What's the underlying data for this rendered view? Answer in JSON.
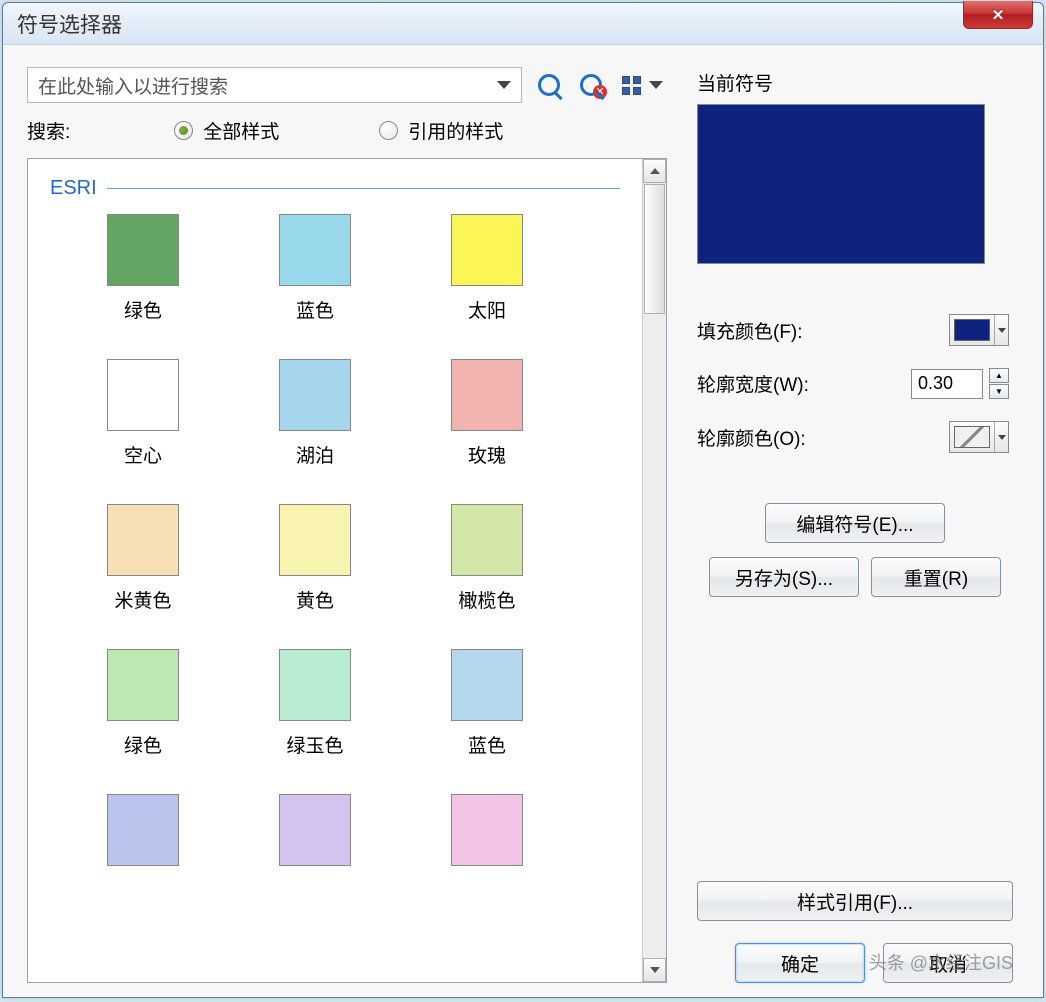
{
  "window": {
    "title": "符号选择器"
  },
  "search": {
    "placeholder": "在此处输入以进行搜索",
    "label": "搜索:",
    "radio_all": "全部样式",
    "radio_ref": "引用的样式"
  },
  "group": {
    "name": "ESRI"
  },
  "symbols": [
    {
      "label": "绿色",
      "color": "#63a563"
    },
    {
      "label": "蓝色",
      "color": "#9ad8eb"
    },
    {
      "label": "太阳",
      "color": "#fcf556"
    },
    {
      "label": "空心",
      "color": "#ffffff"
    },
    {
      "label": "湖泊",
      "color": "#a5d5eb"
    },
    {
      "label": "玫瑰",
      "color": "#f2b4b0"
    },
    {
      "label": "米黄色",
      "color": "#f7e0b5"
    },
    {
      "label": "黄色",
      "color": "#f8f3ae"
    },
    {
      "label": "橄榄色",
      "color": "#d3e8a8"
    },
    {
      "label": "绿色",
      "color": "#bce8b2"
    },
    {
      "label": "绿玉色",
      "color": "#b8ecd0"
    },
    {
      "label": "蓝色",
      "color": "#b6d8ee"
    },
    {
      "label": "",
      "color": "#bac5ee"
    },
    {
      "label": "",
      "color": "#d4c3f0"
    },
    {
      "label": "",
      "color": "#f4c4e6"
    }
  ],
  "current": {
    "label": "当前符号",
    "preview_color": "#0d237e",
    "fill_label": "填充颜色(F):",
    "fill_value": "#0d237e",
    "outline_width_label": "轮廓宽度(W):",
    "outline_width": "0.30",
    "outline_color_label": "轮廓颜色(O):"
  },
  "buttons": {
    "edit_symbol": "编辑符号(E)...",
    "save_as": "另存为(S)...",
    "reset": "重置(R)",
    "style_ref": "样式引用(F)...",
    "ok": "确定",
    "cancel": "取消"
  },
  "watermark": "头条 @水经注GIS"
}
